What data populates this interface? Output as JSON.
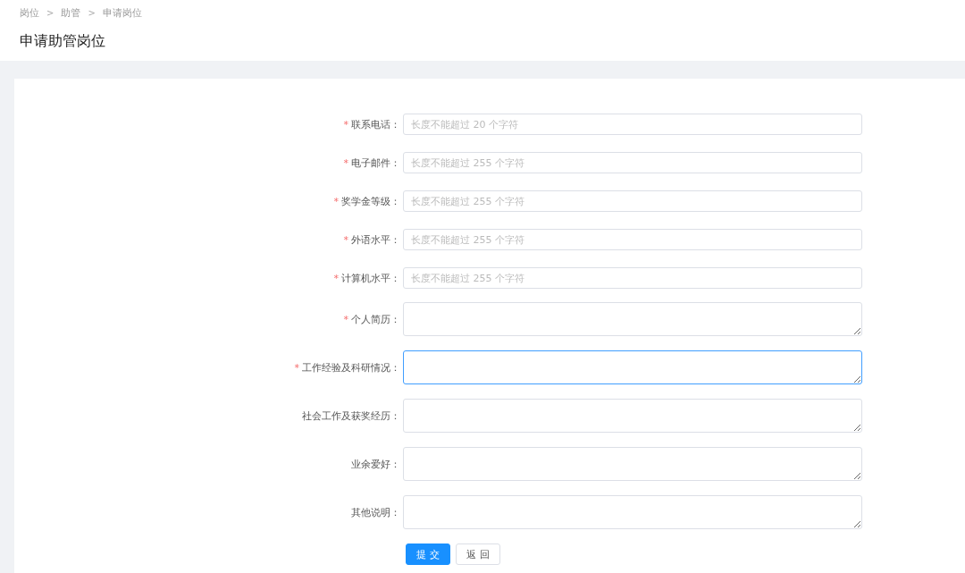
{
  "breadcrumb": [
    {
      "label": "岗位",
      "separator": ">"
    },
    {
      "label": "助管",
      "separator": ">"
    },
    {
      "label": "申请岗位"
    }
  ],
  "page_title": "申请助管岗位",
  "fields": [
    {
      "kind": "input",
      "label": "联系电话：",
      "required_mark": "*",
      "placeholder": "长度不能超过 20 个字符",
      "focused": false
    },
    {
      "kind": "input",
      "label": "电子邮件：",
      "required_mark": "*",
      "placeholder": "长度不能超过 255 个字符",
      "focused": false
    },
    {
      "kind": "input",
      "label": "奖学金等级：",
      "required_mark": "*",
      "placeholder": "长度不能超过 255 个字符",
      "focused": false
    },
    {
      "kind": "input",
      "label": "外语水平：",
      "required_mark": "*",
      "placeholder": "长度不能超过 255 个字符",
      "focused": false
    },
    {
      "kind": "input",
      "label": "计算机水平：",
      "required_mark": "*",
      "placeholder": "长度不能超过 255 个字符",
      "focused": false
    },
    {
      "kind": "textarea",
      "label": "个人简历：",
      "required_mark": "*",
      "focused": false
    },
    {
      "kind": "textarea",
      "label": "工作经验及科研情况：",
      "required_mark": "*",
      "focused": true
    },
    {
      "kind": "textarea",
      "label": "社会工作及获奖经历：",
      "focused": false
    },
    {
      "kind": "textarea",
      "label": "业余爱好：",
      "focused": false
    },
    {
      "kind": "textarea",
      "label": "其他说明：",
      "focused": false
    }
  ],
  "buttons": [
    {
      "label": "提 交",
      "kind": "primary"
    },
    {
      "label": "返 回",
      "kind": "default"
    }
  ]
}
